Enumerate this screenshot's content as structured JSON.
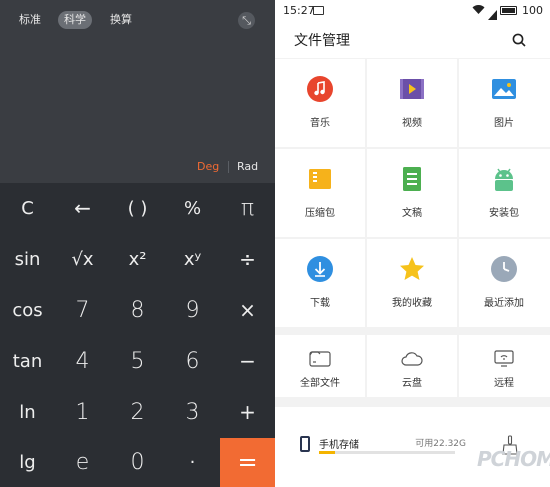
{
  "calculator": {
    "tabs": [
      "标准",
      "科学",
      "换算"
    ],
    "active_tab": "科学",
    "modes": {
      "deg": "Deg",
      "rad": "Rad",
      "active": "Deg"
    },
    "colors": {
      "background": "#3a3d42",
      "key": "#2b2e33",
      "accent": "#f26b33"
    },
    "keys": [
      [
        "C",
        "←",
        "( )",
        "%",
        "π"
      ],
      [
        "sin",
        "√x",
        "x²",
        "xʸ",
        "÷"
      ],
      [
        "cos",
        "7",
        "8",
        "9",
        "×"
      ],
      [
        "tan",
        "4",
        "5",
        "6",
        "−"
      ],
      [
        "ln",
        "1",
        "2",
        "3",
        "+"
      ],
      [
        "lg",
        "e",
        "0",
        "·",
        "="
      ]
    ]
  },
  "file_manager": {
    "status": {
      "time": "15:27",
      "battery": "100"
    },
    "title": "文件管理",
    "categories": [
      {
        "label": "音乐",
        "icon": "music-icon",
        "color": "#e8452d"
      },
      {
        "label": "视频",
        "icon": "video-icon",
        "color": "#6b4fa8"
      },
      {
        "label": "图片",
        "icon": "picture-icon",
        "color": "#2f8fe0"
      },
      {
        "label": "压缩包",
        "icon": "archive-icon",
        "color": "#f6b21b"
      },
      {
        "label": "文稿",
        "icon": "document-icon",
        "color": "#4caf50"
      },
      {
        "label": "安装包",
        "icon": "android-icon",
        "color": "#5cc28b"
      },
      {
        "label": "下载",
        "icon": "download-icon",
        "color": "#2f8fe0"
      },
      {
        "label": "我的收藏",
        "icon": "star-icon",
        "color": "#f6c21b"
      },
      {
        "label": "最近添加",
        "icon": "clock-icon",
        "color": "#9aa8b8"
      }
    ],
    "locations": [
      {
        "label": "全部文件",
        "icon": "all-files-icon"
      },
      {
        "label": "云盘",
        "icon": "cloud-icon"
      },
      {
        "label": "远程",
        "icon": "remote-icon"
      }
    ],
    "storage": {
      "name": "手机存储",
      "free": "可用22.32G",
      "used_fraction": 0.12
    },
    "watermark": "PCHOME"
  }
}
